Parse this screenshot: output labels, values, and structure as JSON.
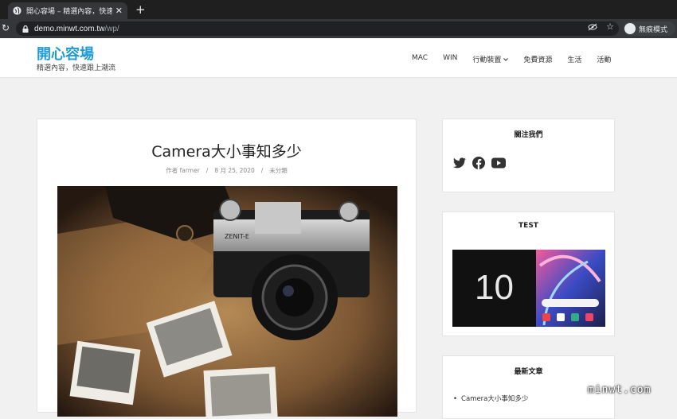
{
  "browser": {
    "tab_title": "開心容場 – 精選內容，快速跟上潮",
    "url_host": "demo.minwt.com.tw",
    "url_path": "/wp/",
    "incognito_label": "無痕模式"
  },
  "site": {
    "brand": "開心容場",
    "tagline": "精選內容，快速跟上潮流",
    "nav": [
      "MAC",
      "WIN",
      "行動裝置",
      "免費資源",
      "生活",
      "活動"
    ]
  },
  "post": {
    "title": "Camera大小事知多少",
    "author": "作者 farmer",
    "date": "8 月 25, 2020",
    "category": "未分類",
    "sep": "/"
  },
  "sidebar": {
    "follow_title": "關注我們",
    "follow_icons": [
      "twitter-icon",
      "facebook-icon",
      "youtube-icon"
    ],
    "test_title": "TEST",
    "test_image_text": "10",
    "recent_title": "最新文章",
    "recent_items": [
      "Camera大小事知多少"
    ]
  },
  "watermark": "minwt.com",
  "colors": {
    "brand": "#1e9ad6",
    "page_bg": "#f1f1f1",
    "chrome_dark": "#35363a"
  }
}
